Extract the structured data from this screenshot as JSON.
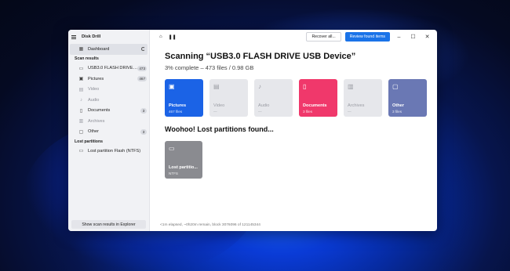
{
  "app": {
    "title": "Disk Drill"
  },
  "sidebar": {
    "dashboard_label": "Dashboard",
    "scan_results_heading": "Scan results",
    "items": [
      {
        "label": "USB3.0 FLASH DRIVE US...",
        "badge": "473",
        "icon": "drive-icon"
      },
      {
        "label": "Pictures",
        "badge": "467",
        "icon": "picture-icon"
      },
      {
        "label": "Video",
        "badge": "",
        "icon": "video-icon"
      },
      {
        "label": "Audio",
        "badge": "",
        "icon": "audio-icon"
      },
      {
        "label": "Documents",
        "badge": "3",
        "icon": "document-icon"
      },
      {
        "label": "Archives",
        "badge": "",
        "icon": "archive-icon"
      },
      {
        "label": "Other",
        "badge": "3",
        "icon": "file-icon"
      }
    ],
    "lost_partitions_heading": "Lost partitions",
    "lost_partition_item": "Lost partition Flash (NTFS)",
    "footer_button": "Show scan results in Explorer"
  },
  "toolbar": {
    "recover_all": "Recover all...",
    "review_found": "Review found items"
  },
  "main": {
    "title": "Scanning “USB3.0 FLASH DRIVE USB Device”",
    "subtitle": "3% complete – 473 files / 0.98 GB",
    "tiles": [
      {
        "name": "Pictures",
        "count": "467 files",
        "style": "blue",
        "icon": "picture-icon"
      },
      {
        "name": "Video",
        "count": "—",
        "style": "grey",
        "icon": "video-icon"
      },
      {
        "name": "Audio",
        "count": "—",
        "style": "grey",
        "icon": "audio-icon"
      },
      {
        "name": "Documents",
        "count": "3 files",
        "style": "pink",
        "icon": "document-icon"
      },
      {
        "name": "Archives",
        "count": "—",
        "style": "grey",
        "icon": "archive-icon"
      },
      {
        "name": "Other",
        "count": "3 files",
        "style": "slate",
        "icon": "file-icon"
      }
    ],
    "lost_title": "Woohoo! Lost partitions found...",
    "partition_tile": {
      "name": "Lost partitio...",
      "fs": "NTFS",
      "icon": "drive-icon"
    }
  },
  "status": "<1m elapsed, ~0h20m remain, block 3076096 of 121145344",
  "colors": {
    "accent": "#1a73e8",
    "pictures_tile": "#1b63e6",
    "documents_tile": "#f0386b",
    "other_tile": "#6a78b4",
    "partition_tile": "#8a8b90"
  }
}
